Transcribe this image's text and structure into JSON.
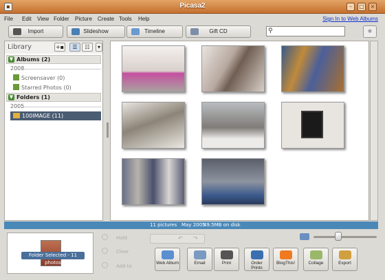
{
  "window": {
    "title": "Picasa2"
  },
  "menubar": {
    "items": [
      "File",
      "Edit",
      "View",
      "Folder",
      "Picture",
      "Create",
      "Tools",
      "Help"
    ],
    "signin": "Sign In to Web Albums"
  },
  "toolbar": {
    "import": "Import",
    "slideshow": "Slideshow",
    "timeline": "Timeline",
    "giftcd": "Gift CD"
  },
  "search": {
    "placeholder": ""
  },
  "library": {
    "title": "Library",
    "albums": {
      "label": "Albums (2)",
      "year": "2008",
      "items": [
        "Screensaver (0)",
        "Starred Photos (0)"
      ]
    },
    "folders": {
      "label": "Folders (1)",
      "year": "2005",
      "selected": "100IMAGE (11)"
    }
  },
  "thumbs": [
    {
      "name": "dry-grass-vase"
    },
    {
      "name": "computer-parts"
    },
    {
      "name": "motherboard"
    },
    {
      "name": "snowy-chair"
    },
    {
      "name": "winter-trees"
    },
    {
      "name": "framed-art"
    },
    {
      "name": "hanging-shirts"
    },
    {
      "name": "electronics-shelf"
    }
  ],
  "statusbar": {
    "count": "11 pictures",
    "date": "May 2005",
    "size": "49.5MB on disk"
  },
  "tray": {
    "label": "Folder Selected - 11 photos",
    "hold": "Hold",
    "clear": "Clear",
    "addto": "Add to"
  },
  "actions": [
    {
      "id": "web-album",
      "label": "Web Album",
      "color": "#5b8fd0"
    },
    {
      "id": "email",
      "label": "Email",
      "color": "#7a9ac2"
    },
    {
      "id": "print",
      "label": "Print",
      "color": "#555555"
    },
    {
      "id": "order-prints",
      "label": "Order Prints",
      "color": "#3a6fb0"
    },
    {
      "id": "blogthis",
      "label": "BlogThis!",
      "color": "#f07a20"
    },
    {
      "id": "collage",
      "label": "Collage",
      "color": "#9ab86a"
    },
    {
      "id": "export",
      "label": "Export",
      "color": "#d0a040"
    }
  ],
  "zoom": {
    "level": 0.38
  }
}
